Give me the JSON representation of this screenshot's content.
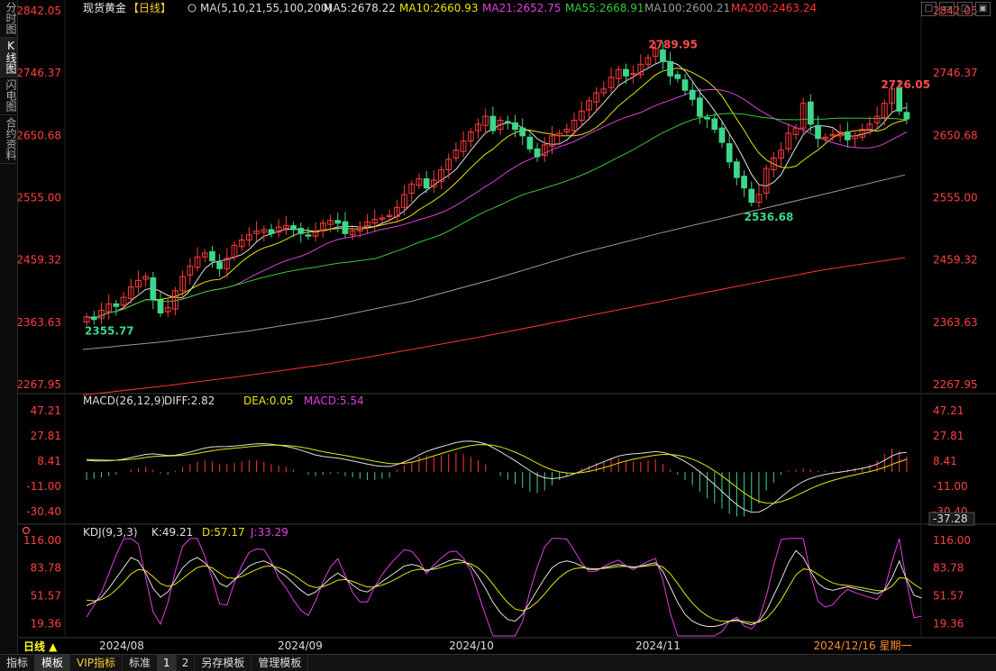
{
  "sidebar": {
    "tabs": [
      {
        "label": "分时图",
        "active": false
      },
      {
        "label": "K线图",
        "active": true
      },
      {
        "label": "闪电图",
        "active": false
      },
      {
        "label": "合约资料",
        "active": false
      }
    ]
  },
  "header": {
    "symbol": "现货黄金",
    "period_tag": "【日线】",
    "ma_label": "MA(5,10,21,55,100,200)",
    "ma_values": [
      {
        "text": "MA5:2678.22",
        "color": "#e0e0e0"
      },
      {
        "text": "MA10:2660.93",
        "color": "#e6e600"
      },
      {
        "text": "MA21:2652.75",
        "color": "#e040e0"
      },
      {
        "text": "MA55:2668.91",
        "color": "#33cc33"
      },
      {
        "text": "MA100:2600.21",
        "color": "#999999"
      },
      {
        "text": "MA200:2463.24",
        "color": "#ff3333"
      }
    ]
  },
  "window_buttons": [
    "□",
    "▭",
    "▢",
    "▣"
  ],
  "price_axis": [
    "2842.05",
    "2746.37",
    "2650.68",
    "2555.00",
    "2459.32",
    "2363.63",
    "2267.95"
  ],
  "annotations": {
    "high": "2789.95",
    "high2": "2726.05",
    "low": "2536.68",
    "start_low": "2355.77"
  },
  "macd": {
    "title": "MACD(26,12,9)",
    "diff": "DIFF:2.82",
    "dea": "DEA:0.05",
    "macd": "MACD:5.54",
    "axis": [
      "47.21",
      "27.81",
      "8.41",
      "-11.00",
      "-30.40"
    ],
    "current": "-37.28"
  },
  "kdj": {
    "title": "KDJ(9,3,3)",
    "k": "K:49.21",
    "d": "D:57.17",
    "j": "J:33.29",
    "axis": [
      "116.00",
      "83.78",
      "51.57",
      "19.36"
    ]
  },
  "dates": [
    "2024/08",
    "2024/09",
    "2024/10",
    "2024/11"
  ],
  "cursor_date": "2024/12/16 星期一",
  "period_button": "日线 ▲",
  "bottom_bar": [
    "指标",
    "模板",
    "VIP指标",
    "标准",
    "1",
    "2",
    "另存模板",
    "管理模板"
  ],
  "colors": {
    "up": "#ff3b3b",
    "down": "#3ed68b",
    "ma5": "#e0e0e0",
    "ma10": "#e6e600",
    "ma21": "#e040e0",
    "ma55": "#33cc33",
    "ma100": "#999999",
    "ma200": "#ff3333",
    "axis_text": "#ff4040"
  },
  "chart_data": {
    "type": "candlestick",
    "price_range": [
      2250,
      2842.05
    ],
    "ohlc_close": [
      2372,
      2368,
      2382,
      2392,
      2388,
      2402,
      2418,
      2428,
      2434,
      2398,
      2378,
      2386,
      2412,
      2434,
      2450,
      2464,
      2470,
      2458,
      2446,
      2462,
      2482,
      2490,
      2498,
      2504,
      2506,
      2500,
      2510,
      2512,
      2506,
      2500,
      2496,
      2502,
      2516,
      2520,
      2516,
      2500,
      2504,
      2510,
      2518,
      2522,
      2524,
      2528,
      2540,
      2560,
      2576,
      2584,
      2570,
      2582,
      2598,
      2614,
      2628,
      2642,
      2656,
      2668,
      2680,
      2658,
      2674,
      2670,
      2660,
      2650,
      2630,
      2618,
      2636,
      2650,
      2654,
      2660,
      2674,
      2688,
      2704,
      2716,
      2722,
      2740,
      2752,
      2742,
      2746,
      2760,
      2770,
      2784,
      2764,
      2742,
      2738,
      2720,
      2706,
      2680,
      2676,
      2660,
      2640,
      2610,
      2586,
      2570,
      2548,
      2560,
      2600,
      2616,
      2628,
      2654,
      2662,
      2700,
      2668,
      2646,
      2648,
      2652,
      2656,
      2644,
      2650,
      2660,
      2668,
      2680,
      2700,
      2722,
      2688,
      2676
    ],
    "macd_hist": [
      -6,
      -5,
      -4,
      -3,
      -2,
      0,
      2,
      3,
      4,
      2,
      -1,
      -2,
      1,
      4,
      6,
      8,
      9,
      8,
      6,
      6,
      7,
      8,
      9,
      9,
      8,
      6,
      5,
      4,
      2,
      0,
      -2,
      -3,
      -2,
      -1,
      -1,
      -3,
      -4,
      -5,
      -6,
      -6,
      -5,
      -4,
      2,
      5,
      8,
      12,
      13,
      12,
      13,
      14,
      15,
      14,
      12,
      9,
      6,
      0,
      -3,
      -6,
      -9,
      -12,
      -15,
      -16,
      -14,
      -10,
      -6,
      -3,
      0,
      3,
      5,
      7,
      8,
      10,
      11,
      9,
      8,
      8,
      9,
      10,
      6,
      2,
      -2,
      -6,
      -10,
      -15,
      -20,
      -24,
      -28,
      -32,
      -34,
      -34,
      -30,
      -24,
      -14,
      -8,
      -2,
      1,
      2,
      3,
      2,
      1,
      1,
      1,
      1,
      2,
      3,
      4,
      6,
      9,
      14,
      18,
      16,
      12
    ],
    "kdj_k": [
      40,
      44,
      50,
      60,
      72,
      84,
      96,
      92,
      78,
      60,
      50,
      56,
      70,
      84,
      92,
      96,
      90,
      80,
      66,
      62,
      70,
      78,
      86,
      90,
      92,
      88,
      80,
      74,
      66,
      58,
      52,
      56,
      64,
      72,
      78,
      72,
      64,
      58,
      56,
      62,
      68,
      74,
      80,
      86,
      88,
      86,
      80,
      84,
      88,
      92,
      94,
      92,
      86,
      74,
      60,
      44,
      32,
      24,
      22,
      30,
      44,
      58,
      72,
      84,
      90,
      92,
      90,
      86,
      82,
      82,
      84,
      86,
      88,
      86,
      84,
      86,
      88,
      90,
      80,
      62,
      44,
      30,
      22,
      18,
      16,
      16,
      18,
      22,
      24,
      20,
      18,
      22,
      34,
      52,
      70,
      90,
      104,
      96,
      80,
      66,
      60,
      58,
      60,
      62,
      60,
      58,
      56,
      54,
      58,
      72,
      92,
      70,
      52,
      49
    ]
  }
}
